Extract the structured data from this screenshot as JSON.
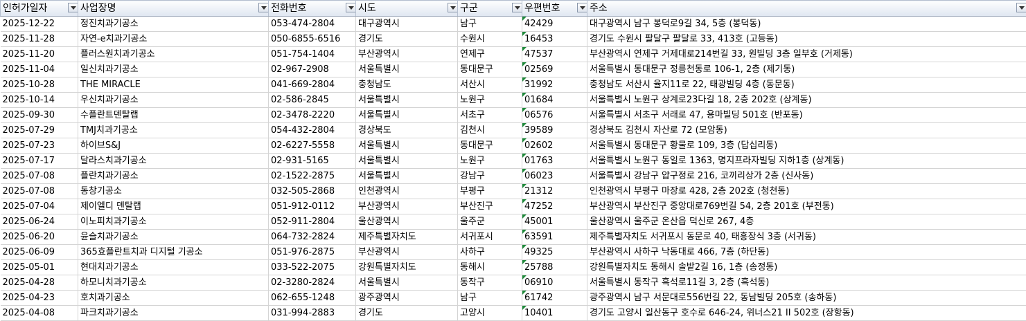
{
  "columns": [
    "인허가일자",
    "사업장명",
    "전화번호",
    "시도",
    "구군",
    "우편번호",
    "주소"
  ],
  "rows": [
    [
      "2025-12-22",
      "정진치과기공소",
      "053-474-2804",
      "대구광역시",
      "남구",
      "42429",
      "대구광역시 남구 봉덕로9길 34, 5층 (봉덕동)"
    ],
    [
      "2025-11-28",
      "자연-e치과기공소",
      "050-6855-6516",
      "경기도",
      "수원시",
      "16453",
      "경기도 수원시 팔달구 팔달로 33, 413호 (고등동)"
    ],
    [
      "2025-11-20",
      "플러스원치과기공소",
      "051-754-1404",
      "부산광역시",
      "연제구",
      "47537",
      "부산광역시 연제구 거제대로214번길 33, 원빌딩 3층 일부호 (거제동)"
    ],
    [
      "2025-11-04",
      "일신치과기공소",
      "02-967-2908",
      "서울특별시",
      "동대문구",
      "02569",
      "서울특별시 동대문구 정릉천동로 106-1, 2층 (제기동)"
    ],
    [
      "2025-10-28",
      "THE MIRACLE",
      "041-669-2804",
      "충청남도",
      "서산시",
      "31992",
      "충청남도 서산시 율지11로 22, 태광빌딩 4층 (동문동)"
    ],
    [
      "2025-10-14",
      "우신치과기공소",
      "02-586-2845",
      "서울특별시",
      "노원구",
      "01684",
      "서울특별시 노원구 상계로23다길 18, 2층 202호 (상계동)"
    ],
    [
      "2025-09-30",
      "수플란트덴탈랩",
      "02-3478-2220",
      "서울특별시",
      "서초구",
      "06576",
      "서울특별시 서초구 서래로 47, 용마빌딩 501호 (반포동)"
    ],
    [
      "2025-07-29",
      "TMJ치과기공소",
      "054-432-2804",
      "경상북도",
      "김천시",
      "39589",
      "경상북도 김천시 자산로 72 (모암동)"
    ],
    [
      "2025-07-23",
      "하이브S&J",
      "02-6227-5558",
      "서울특별시",
      "동대문구",
      "02602",
      "서울특별시 동대문구 황물로 109, 3층 (답십리동)"
    ],
    [
      "2025-07-17",
      "달라스치과기공소",
      "02-931-5165",
      "서울특별시",
      "노원구",
      "01763",
      "서울특별시 노원구 동일로 1363, 명지프라자빌딩 지하1층 (상계동)"
    ],
    [
      "2025-07-08",
      "플란치과기공소",
      "02-1522-2875",
      "서울특별시",
      "강남구",
      "06023",
      "서울특별시 강남구 압구정로 216, 코끼리상가 2층 (신사동)"
    ],
    [
      "2025-07-08",
      "동창기공소",
      "032-505-2868",
      "인천광역시",
      "부평구",
      "21312",
      "인천광역시 부평구 마장로 428, 2층 202호 (청천동)"
    ],
    [
      "2025-07-04",
      "제이엘디 덴탈랩",
      "051-912-0112",
      "부산광역시",
      "부산진구",
      "47252",
      "부산광역시 부산진구 중앙대로769번길 54, 2층 201호 (부전동)"
    ],
    [
      "2025-06-24",
      "이노피치과기공소",
      "052-911-2804",
      "울산광역시",
      "울주군",
      "45001",
      "울산광역시 울주군 온산읍 덕신로 267, 4층"
    ],
    [
      "2025-06-20",
      "윤슬치과기공소",
      "064-732-2824",
      "제주특별자치도",
      "서귀포시",
      "63591",
      "제주특별자치도 서귀포시 동문로 40, 태흥장식 3층 (서귀동)"
    ],
    [
      "2025-06-09",
      "365효플란트치과 디지털 기공소",
      "051-976-2875",
      "부산광역시",
      "사하구",
      "49325",
      "부산광역시 사하구 낙동대로 466, 7층 (하단동)"
    ],
    [
      "2025-05-01",
      "현대치과기공소",
      "033-522-2075",
      "강원특별자치도",
      "동해시",
      "25788",
      "강원특별자치도 동해시 솔밭2길 16, 1층 (송정동)"
    ],
    [
      "2025-04-28",
      "하모니치과기공소",
      "02-3280-2824",
      "서울특별시",
      "동작구",
      "06910",
      "서울특별시 동작구 흑석로11길 3, 2층 (흑석동)"
    ],
    [
      "2025-04-23",
      "호치과기공소",
      "062-655-1248",
      "광주광역시",
      "남구",
      "61742",
      "광주광역시 남구 서문대로556번길 22, 동남빌딩 205호 (송하동)"
    ],
    [
      "2025-04-08",
      "파크치과기공소",
      "031-994-2883",
      "경기도",
      "고양시",
      "10401",
      "경기도 고양시 일산동구 호수로 646-24, 위너스21 II 502호 (장항동)"
    ]
  ]
}
